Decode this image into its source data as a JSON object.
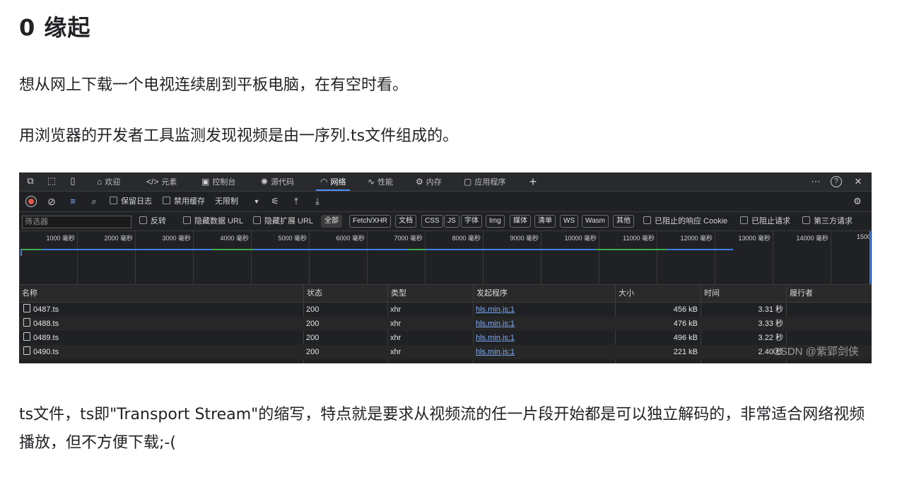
{
  "article": {
    "heading": "0 缘起",
    "p1": "想从网上下载一个电视连续剧到平板电脑，在有空时看。",
    "p2": "用浏览器的开发者工具监测发现视频是由一序列.ts文件组成的。",
    "p3": "ts文件，ts即\"Transport Stream\"的缩写，特点就是要求从视频流的任一片段开始都是可以独立解码的，非常适合网络视频播放，但不方便下载;-("
  },
  "devtools": {
    "tabs": [
      {
        "label": "欢迎",
        "icon": "home-icon"
      },
      {
        "label": "元素",
        "icon": "code-icon"
      },
      {
        "label": "控制台",
        "icon": "console-icon"
      },
      {
        "label": "源代码",
        "icon": "bug-icon"
      },
      {
        "label": "网络",
        "icon": "wifi-icon"
      },
      {
        "label": "性能",
        "icon": "performance-icon"
      },
      {
        "label": "内存",
        "icon": "gear-icon"
      },
      {
        "label": "应用程序",
        "icon": "app-icon"
      }
    ],
    "active_tab": "网络",
    "toolbar": {
      "preserve_log": "保留日志",
      "disable_cache": "禁用缓存",
      "throttling": "无限制"
    },
    "filter": {
      "placeholder": "筛选器",
      "invert": "反转",
      "hide_data_urls": "隐藏数据 URL",
      "hide_ext_urls": "隐藏扩展 URL",
      "types": [
        "全部",
        "Fetch/XHR",
        "文档",
        "CSS",
        "JS",
        "字体",
        "Img",
        "媒体",
        "清单",
        "WS",
        "Wasm",
        "其他"
      ],
      "selected_type": "全部",
      "blocked_cookies": "已阻止的响应 Cookie",
      "blocked_requests": "已阻止请求",
      "third_party": "第三方请求"
    },
    "timeline_ticks": [
      "1000 毫秒",
      "2000 毫秒",
      "3000 毫秒",
      "4000 毫秒",
      "5000 毫秒",
      "6000 毫秒",
      "7000 毫秒",
      "8000 毫秒",
      "9000 毫秒",
      "10000 毫秒",
      "11000 毫秒",
      "12000 毫秒",
      "13000 毫秒",
      "14000 毫秒",
      "1500"
    ],
    "columns": [
      "名称",
      "状态",
      "类型",
      "发起程序",
      "大小",
      "时间",
      "履行者"
    ],
    "rows": [
      {
        "name": "0487.ts",
        "status": "200",
        "type": "xhr",
        "initiator": "hls.min.js:1",
        "size": "456 kB",
        "time": "3.31 秒"
      },
      {
        "name": "0488.ts",
        "status": "200",
        "type": "xhr",
        "initiator": "hls.min.js:1",
        "size": "476 kB",
        "time": "3.33 秒"
      },
      {
        "name": "0489.ts",
        "status": "200",
        "type": "xhr",
        "initiator": "hls.min.js:1",
        "size": "496 kB",
        "time": "3.22 秒"
      },
      {
        "name": "0490.ts",
        "status": "200",
        "type": "xhr",
        "initiator": "hls.min.js:1",
        "size": "221 kB",
        "time": "2.40 秒"
      }
    ],
    "watermark": "CSDN @紫郢剑侠",
    "colors": {
      "accent": "#4d90fe",
      "record": "#e5554a",
      "link": "#7cacf8",
      "bar_green": "#3fae49",
      "bar_blue": "#3f7fe0"
    }
  }
}
